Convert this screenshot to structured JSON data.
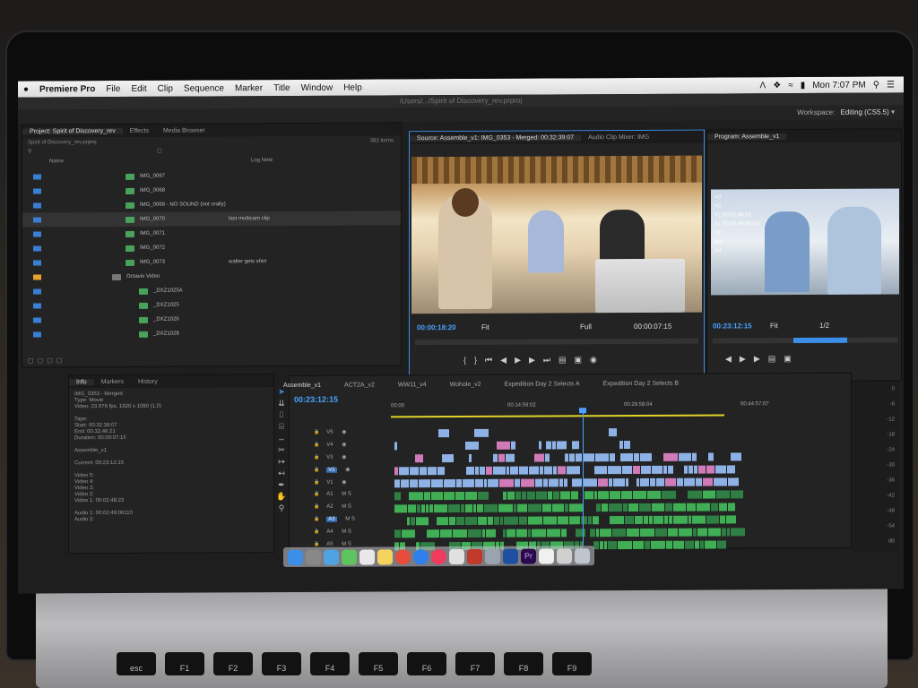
{
  "menubar": {
    "app": "Premiere Pro",
    "items": [
      "File",
      "Edit",
      "Clip",
      "Sequence",
      "Marker",
      "Title",
      "Window",
      "Help"
    ],
    "clock": "Mon 7:07 PM"
  },
  "titlebar": "/Users/.../Spirit of Discovery_rev.prproj",
  "workspace": {
    "label": "Workspace:",
    "value": "Editing (CS5.5)"
  },
  "project_panel": {
    "tabs": [
      "Project: Spirit of Discovery_rev",
      "Effects",
      "Media Browser"
    ],
    "file": "Spirit of Discovery_rev.prproj",
    "count": "383 Items",
    "col_name": "Name",
    "col_log": "Log Note",
    "rows": [
      {
        "name": "IMG_0067",
        "note": ""
      },
      {
        "name": "IMG_0068",
        "note": ""
      },
      {
        "name": "IMG_0069 - NO SOUND (not really)",
        "note": ""
      },
      {
        "name": "IMG_0070",
        "note": "last multicam clip"
      },
      {
        "name": "IMG_0071",
        "note": ""
      },
      {
        "name": "IMG_0072",
        "note": ""
      },
      {
        "name": "IMG_0073",
        "note": "walter gets shirt"
      },
      {
        "name": "Octavio Video",
        "note": ""
      },
      {
        "name": "_DXZ1025A",
        "note": ""
      },
      {
        "name": "_DXZ1025",
        "note": ""
      },
      {
        "name": "_DXZ1026",
        "note": ""
      },
      {
        "name": "_DXZ1028",
        "note": ""
      }
    ]
  },
  "source_panel": {
    "tab": "Source: Assemble_v1: IMG_0353 - Merged: 00:32:39:07",
    "tab2": "Audio Clip Mixer: IMG",
    "tc_in": "00:00:18:20",
    "fit": "Fit",
    "full": "Full",
    "tc_dur": "00:00:07:15"
  },
  "program_panel": {
    "tab": "Program: Assemble_v1",
    "tc": "00:23:12:15",
    "fit": "Fit",
    "res": "1/2",
    "overlay": [
      "V3",
      "V2",
      "V1 00:02:48:23",
      "A1 00:02:49:06110",
      "A2",
      "A3",
      "A4"
    ]
  },
  "info_panel": {
    "tabs": [
      "Info",
      "Markers",
      "History"
    ],
    "lines": [
      "IMG_0353 - Merged",
      "Type: Movie",
      "Video: 23.976 fps, 1920 x 1080 (1.0)",
      "",
      "Tape:",
      "Start: 00:32:39:07",
      "End: 00:32:46:21",
      "Duration: 00:00:07:15",
      "",
      "Assemble_v1",
      "",
      "Current: 00:23:12:15",
      "",
      "Video 5:",
      "Video 4:",
      "Video 3:",
      "Video 2:",
      "Video 1: 00:02:48:23",
      "",
      "Audio 1: 00:02:49:06110",
      "Audio 2:"
    ]
  },
  "timeline": {
    "tabs": [
      "Assemble_v1",
      "ACT2A_v2",
      "WW11_v4",
      "Wohole_v2",
      "Expedition Day 2 Selects A",
      "Expedition Day 2 Selects B"
    ],
    "tc": "00:23:12:15",
    "ruler": [
      "00:00",
      "00:14:59:02",
      "00:29:58:04",
      "00:44:57:07"
    ],
    "tracks_video": [
      "V5",
      "V4",
      "V3",
      "V2",
      "V1"
    ],
    "tracks_audio": [
      "A1",
      "A2",
      "A3",
      "A4",
      "A5"
    ],
    "meter_ticks": [
      "0",
      "-6",
      "-12",
      "-18",
      "-24",
      "-30",
      "-36",
      "-42",
      "-48",
      "-54",
      "dB"
    ]
  },
  "keyboard": {
    "keys": [
      "esc",
      "F1",
      "F2",
      "F3",
      "F4",
      "F5",
      "F6",
      "F7",
      "F8",
      "F9"
    ]
  },
  "colors": {
    "accent": "#3b8fe8",
    "clip_blue": "#8fb2e6",
    "clip_green": "#3fae55",
    "clip_pink": "#d07ab8",
    "playhead": "#4aa3ff"
  }
}
